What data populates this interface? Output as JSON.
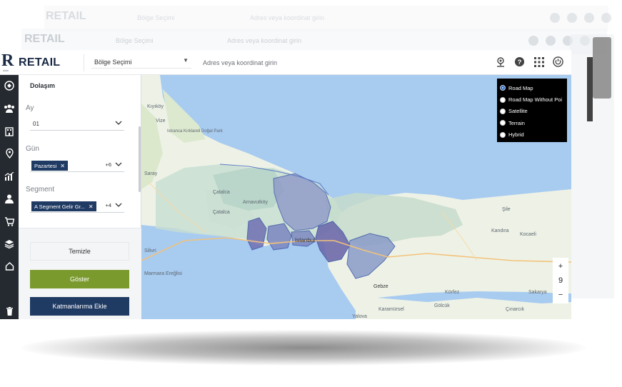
{
  "header": {
    "logo_letter": "R",
    "logo_sub": "data",
    "app_name": "RETAIL",
    "region_select": "Bölge Seçimi",
    "address_placeholder": "Adres veya koordinat girin"
  },
  "panel": {
    "title": "Dolaşım",
    "month": {
      "label": "Ay",
      "value": "01"
    },
    "day": {
      "label": "Gün",
      "chip": "Pazartesi",
      "more": "+6"
    },
    "segment": {
      "label": "Segment",
      "chip": "A Segment Gelir Gr...",
      "more": "+4"
    },
    "buttons": {
      "clear": "Temizle",
      "show": "Göster",
      "add_layer": "Katmanlarıma Ekle"
    }
  },
  "map": {
    "layers": [
      {
        "label": "Road Map",
        "selected": true
      },
      {
        "label": "Road Map Without Poi",
        "selected": false
      },
      {
        "label": "Satellite",
        "selected": false
      },
      {
        "label": "Terrain",
        "selected": false
      },
      {
        "label": "Hybrid",
        "selected": false
      }
    ],
    "zoom_level": "9",
    "zoom_in": "+",
    "zoom_out": "−",
    "place_labels": [
      "Kıyıköy",
      "Vize",
      "Saray",
      "Istranca Kırklareli Doğal Park",
      "Çatalca",
      "Arnavutköy",
      "Silivri",
      "Çatalca",
      "Istanbul",
      "Şile",
      "Kandıra",
      "Kocaeli",
      "Gebze",
      "Körfez",
      "Sakarya",
      "Gölcük",
      "Karamürsel",
      "Yalova",
      "Çınarcık",
      "Marmara Ereğlisi"
    ]
  },
  "colors": {
    "brand_dark": "#1a2a44",
    "rail": "#252a30",
    "accent_green": "#7a9a2e",
    "accent_blue": "#1f3a63",
    "sea": "#a8cbf0",
    "land": "#eef2e6"
  },
  "background": {
    "ghost_app_name_1": "RETAIL",
    "ghost_app_name_2": "RETAIL",
    "ghost_region_1": "Bölge Seçimi",
    "ghost_region_2": "Bölge Seçimi",
    "ghost_address_1": "Adres veya koordinat girin",
    "ghost_address_2": "Adres veya koordinat girin"
  }
}
